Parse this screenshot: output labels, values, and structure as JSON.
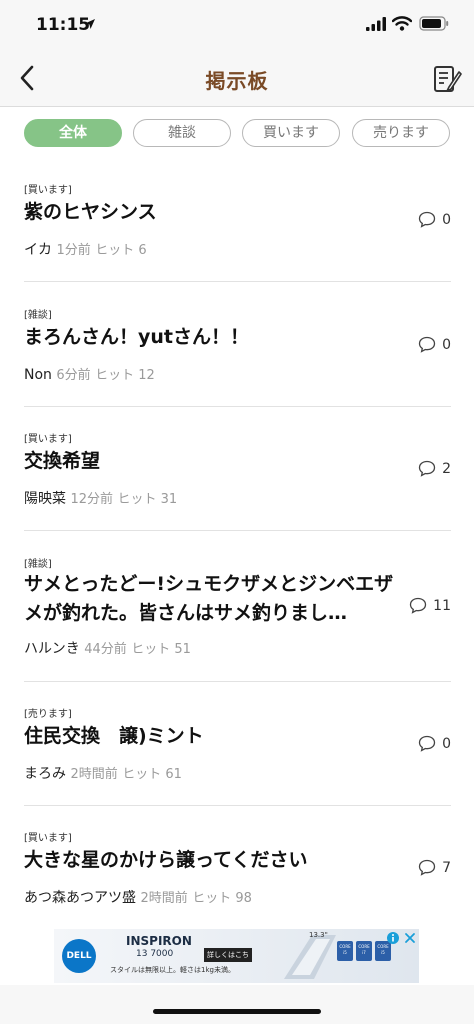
{
  "status": {
    "time": "11:15"
  },
  "nav": {
    "title": "掲示板",
    "back_icon": "chevron-left-icon",
    "compose_icon": "compose-note-icon"
  },
  "filters": [
    {
      "label": "全体",
      "active": true
    },
    {
      "label": "雑談",
      "active": false
    },
    {
      "label": "買います",
      "active": false
    },
    {
      "label": "売ります",
      "active": false
    }
  ],
  "posts": [
    {
      "category": "[買います]",
      "title": "紫のヒヤシンス",
      "author": "イカ",
      "time": "1分前",
      "hits": "ヒット 6",
      "comments": "0"
    },
    {
      "category": "[雑談]",
      "title": "まろんさん！yutさん！！",
      "author": "Non",
      "time": "6分前",
      "hits": "ヒット 12",
      "comments": "0"
    },
    {
      "category": "[買います]",
      "title": "交換希望",
      "author": "陽映菜",
      "time": "12分前",
      "hits": "ヒット 31",
      "comments": "2"
    },
    {
      "category": "[雑談]",
      "title": "サメとったどー!シュモクザメとジンベエザメが釣れた。皆さんはサメ釣りまし…",
      "author": "ハルンき",
      "time": "44分前",
      "hits": "ヒット 51",
      "comments": "11"
    },
    {
      "category": "[売ります]",
      "title": "住民交換　譲)ミント",
      "author": "まろみ",
      "time": "2時間前",
      "hits": "ヒット 61",
      "comments": "0"
    },
    {
      "category": "[買います]",
      "title": "大きな星のかけら譲ってください",
      "author": "あつ森あつアツ盛",
      "time": "2時間前",
      "hits": "ヒット 98",
      "comments": "7"
    }
  ],
  "ad": {
    "brand": "DELL",
    "product": "INSPIRON",
    "model": "13 7000",
    "cta": "詳しくはこちら",
    "tagline": "スタイルは無限以上。軽さは1kg未満。",
    "screen_size": "13.3\"",
    "chip_labels": [
      "CORE i5",
      "CORE i7",
      "CORE i5"
    ]
  }
}
